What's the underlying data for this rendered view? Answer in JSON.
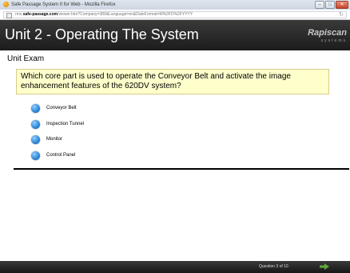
{
  "window": {
    "title": "Safe Passage System II for Web - Mozilla Firefox",
    "url_prefix": "rms.",
    "url_host": "safe-passage.com",
    "url_path": "/viewer.htm?Company=389&Language=en&DateFormat=M%2FD%2FYYYY",
    "controls": [
      "–",
      "□",
      "✕"
    ]
  },
  "header": {
    "title": "Unit 2 - Operating The System",
    "logo": "Rapiscan",
    "logo_sub": "systems"
  },
  "exam": {
    "label": "Unit Exam",
    "question": "Which core part is used to operate the Conveyor Belt and activate the image enhancement features of the 620DV system?",
    "options": [
      "Conveyor Belt",
      "Inspection Tunnel",
      "Monitor",
      "Control Panel"
    ]
  },
  "footer": {
    "progress": "Question 3 of 10",
    "next_icon": "arrow-right-icon",
    "next_color": "#5fa83a"
  }
}
